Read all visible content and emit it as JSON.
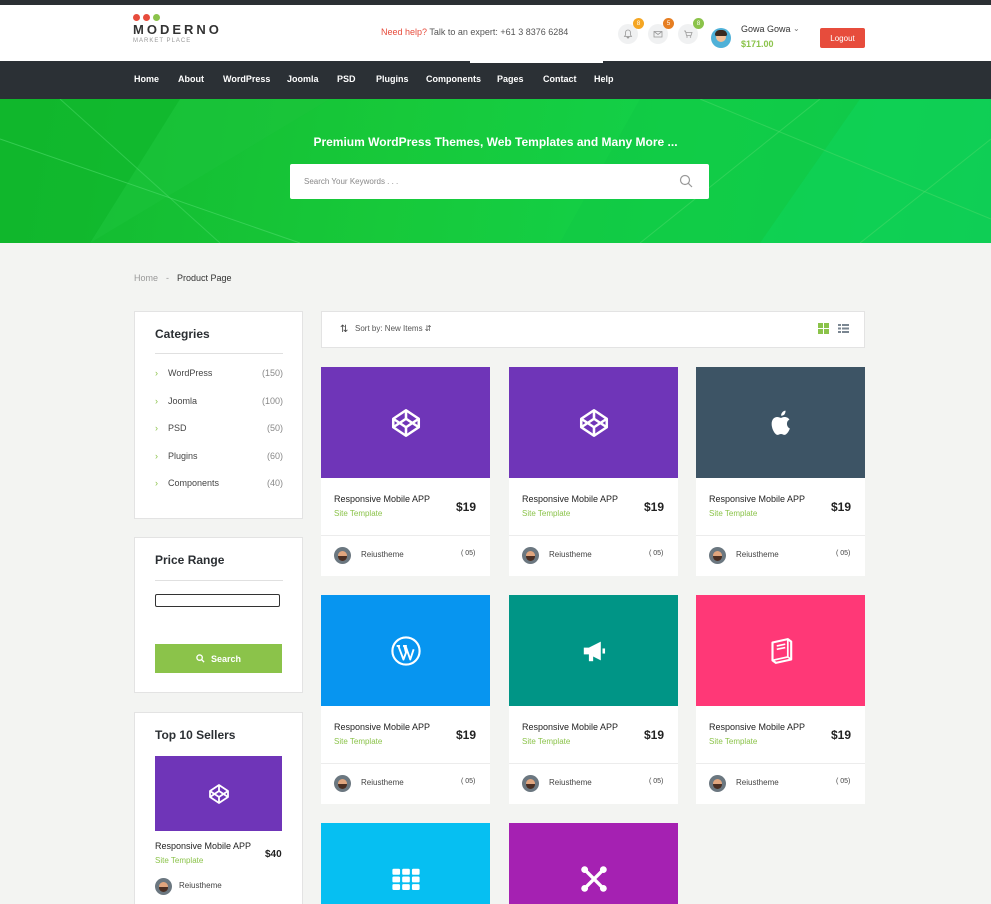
{
  "header": {
    "logo_name": "MODERNO",
    "logo_sub": "MARKET PLACE",
    "help_highlight": "Need help?",
    "help_text": " Talk to an expert: +61 3 8376 6284",
    "notifications": {
      "icon": "bell-icon",
      "count": "8"
    },
    "messages": {
      "icon": "mail-icon",
      "count": "5"
    },
    "cart": {
      "icon": "cart-icon",
      "count": "8"
    },
    "user_name": "Gowa Gowa",
    "balance": "$171.00",
    "logout_label": "Logout"
  },
  "nav": [
    "Home",
    "About",
    "WordPress",
    "Joomla",
    "PSD",
    "Plugins",
    "Components",
    "Pages",
    "Contact",
    "Help"
  ],
  "hero": {
    "title": "Premium WordPress Themes, Web Templates and Many More ...",
    "search_placeholder": "Search Your Keywords . . ."
  },
  "breadcrumb": {
    "home": "Home",
    "separator": "-",
    "current": "Product Page"
  },
  "categories": {
    "title": "Categries",
    "items": [
      {
        "label": "WordPress",
        "count": "(150)"
      },
      {
        "label": "Joomla",
        "count": "(100)"
      },
      {
        "label": "PSD",
        "count": "(50)"
      },
      {
        "label": "Plugins",
        "count": "(60)"
      },
      {
        "label": "Components",
        "count": "(40)"
      }
    ]
  },
  "price_range": {
    "title": "Price Range",
    "button_label": "Search"
  },
  "top_sellers": {
    "title": "Top 10 Sellers",
    "item": {
      "title": "Responsive Mobile APP",
      "type": "Site Template",
      "price": "$40",
      "author": "Reiustheme",
      "icon": "codepen-icon"
    }
  },
  "sort": {
    "label": "Sort by: New Items"
  },
  "products": [
    {
      "title": "Responsive Mobile APP",
      "type": "Site Template",
      "price": "$19",
      "author": "Reiustheme",
      "rating": "( 05)",
      "icon": "codepen-icon",
      "color": "#6f35b8"
    },
    {
      "title": "Responsive Mobile APP",
      "type": "Site Template",
      "price": "$19",
      "author": "Reiustheme",
      "rating": "( 05)",
      "icon": "codepen-icon",
      "color": "#6f35b8"
    },
    {
      "title": "Responsive Mobile APP",
      "type": "Site Template",
      "price": "$19",
      "author": "Reiustheme",
      "rating": "( 05)",
      "icon": "apple-icon",
      "color": "#3d5465"
    },
    {
      "title": "Responsive Mobile APP",
      "type": "Site Template",
      "price": "$19",
      "author": "Reiustheme",
      "rating": "( 05)",
      "icon": "wordpress-icon",
      "color": "#0795f0"
    },
    {
      "title": "Responsive Mobile APP",
      "type": "Site Template",
      "price": "$19",
      "author": "Reiustheme",
      "rating": "( 05)",
      "icon": "megaphone-icon",
      "color": "#009586"
    },
    {
      "title": "Responsive Mobile APP",
      "type": "Site Template",
      "price": "$19",
      "author": "Reiustheme",
      "rating": "( 05)",
      "icon": "book-icon",
      "color": "#ff3877"
    },
    {
      "title": "",
      "type": "",
      "price": "",
      "author": "",
      "rating": "",
      "icon": "grid-icon",
      "color": "#06bff2"
    },
    {
      "title": "",
      "type": "",
      "price": "",
      "author": "",
      "rating": "",
      "icon": "joomla-icon",
      "color": "#a521b2"
    }
  ],
  "colors": {
    "accent": "#8bc34a",
    "danger": "#e74c3c",
    "nav_bg": "#2b3035"
  }
}
